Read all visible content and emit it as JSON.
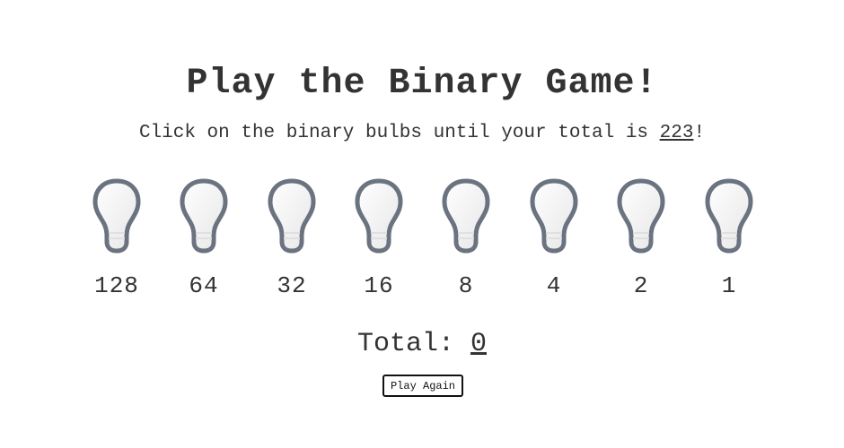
{
  "title": "Play the Binary Game!",
  "instructions": {
    "prefix": "Click on the binary bulbs until your total is ",
    "target": "223",
    "suffix": "!"
  },
  "bulbs": [
    {
      "value": "128",
      "on": false,
      "icon": "lightbulb-icon"
    },
    {
      "value": "64",
      "on": false,
      "icon": "lightbulb-icon"
    },
    {
      "value": "32",
      "on": false,
      "icon": "lightbulb-icon"
    },
    {
      "value": "16",
      "on": false,
      "icon": "lightbulb-icon"
    },
    {
      "value": "8",
      "on": false,
      "icon": "lightbulb-icon"
    },
    {
      "value": "4",
      "on": false,
      "icon": "lightbulb-icon"
    },
    {
      "value": "2",
      "on": false,
      "icon": "lightbulb-icon"
    },
    {
      "value": "1",
      "on": false,
      "icon": "lightbulb-icon"
    }
  ],
  "total": {
    "label": "Total: ",
    "value": "0"
  },
  "play_again_label": "Play Again",
  "colors": {
    "text": "#333333",
    "bulb_outline": "#6b7380",
    "bulb_fill": "#f5f5f5",
    "button_border": "#111111"
  }
}
